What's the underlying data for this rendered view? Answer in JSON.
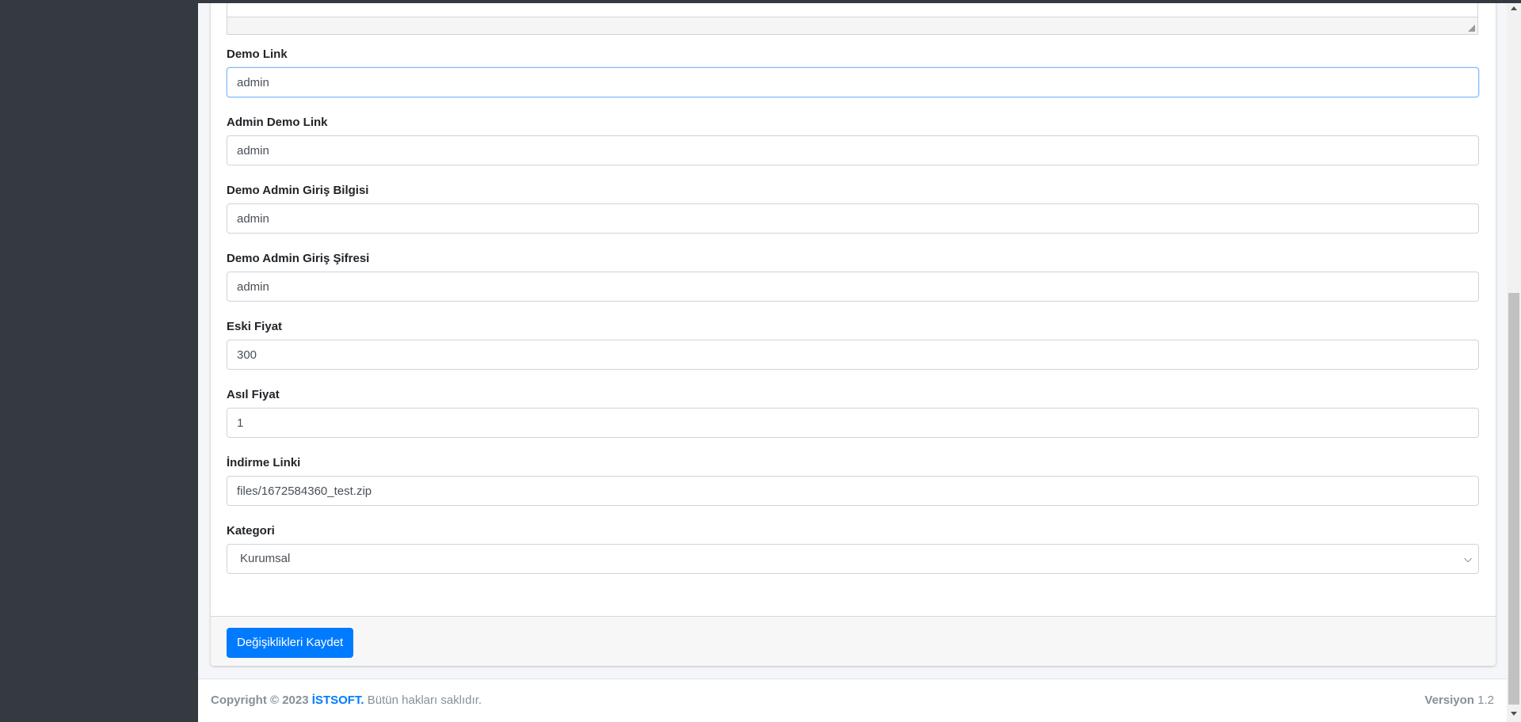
{
  "form": {
    "fields": [
      {
        "label": "Demo Link",
        "value": "admin"
      },
      {
        "label": "Admin Demo Link",
        "value": "admin"
      },
      {
        "label": "Demo Admin Giriş Bilgisi",
        "value": "admin"
      },
      {
        "label": "Demo Admin Giriş Şifresi",
        "value": "admin"
      },
      {
        "label": "Eski Fiyat",
        "value": "300"
      },
      {
        "label": "Asıl Fiyat",
        "value": "1"
      },
      {
        "label": "İndirme Linki",
        "value": "files/1672584360_test.zip"
      }
    ],
    "category": {
      "label": "Kategori",
      "selected": "Kurumsal"
    },
    "save_label": "Değişiklikleri Kaydet"
  },
  "footer": {
    "copyright_prefix": "Copyright © 2023",
    "brand": "İSTSOFT.",
    "rights": "Bütün hakları saklıdır.",
    "version_label": "Versiyon",
    "version_value": "1.2"
  },
  "colors": {
    "sidebar": "#343a40",
    "primary": "#007bff",
    "focus_border": "#80bdff"
  }
}
